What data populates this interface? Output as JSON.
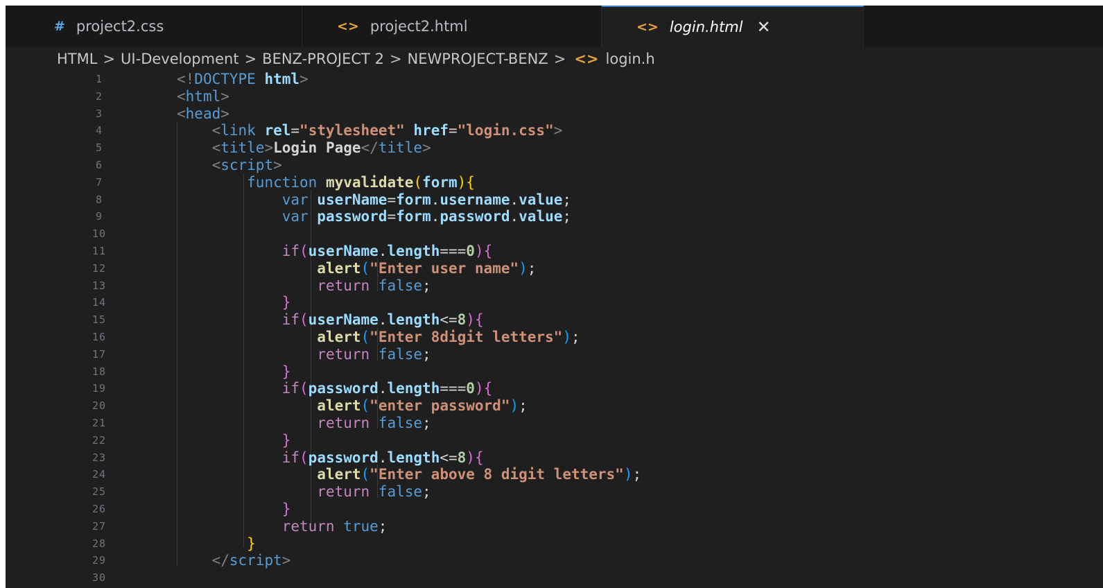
{
  "tabs": [
    {
      "label": "project2.css",
      "icon": "#"
    },
    {
      "label": "project2.html",
      "icon": "<>"
    },
    {
      "label": "login.html",
      "icon": "<>",
      "close": "✕"
    }
  ],
  "breadcrumb": [
    "HTML",
    "UI-Development",
    "BENZ-PROJECT 2",
    "NEWPROJECT-BENZ",
    "login.h"
  ],
  "breadcrumb_separator": ">",
  "breadcrumb_file_icon": "<>",
  "line_numbers": [
    "1",
    "2",
    "3",
    "4",
    "5",
    "6",
    "7",
    "8",
    "9",
    "10",
    "11",
    "12",
    "13",
    "14",
    "15",
    "16",
    "17",
    "18",
    "19",
    "20",
    "21",
    "22",
    "23",
    "24",
    "25",
    "26",
    "27",
    "28",
    "29",
    "30"
  ],
  "code_lines": [
    [
      [
        "<!",
        "punct"
      ],
      [
        "DOCTYPE",
        "tag"
      ],
      [
        " html",
        "attr bold"
      ],
      [
        ">",
        "punct"
      ]
    ],
    [
      [
        "<",
        "punct"
      ],
      [
        "html",
        "tag"
      ],
      [
        ">",
        "punct"
      ]
    ],
    [
      [
        "<",
        "punct"
      ],
      [
        "head",
        "tag"
      ],
      [
        ">",
        "punct"
      ]
    ],
    [
      [
        "    ",
        "text"
      ],
      [
        "<",
        "punct"
      ],
      [
        "link",
        "tag"
      ],
      [
        " rel",
        "attr bold"
      ],
      [
        "=",
        "text"
      ],
      [
        "\"stylesheet\"",
        "str bold"
      ],
      [
        " href",
        "attr bold"
      ],
      [
        "=",
        "text"
      ],
      [
        "\"login.css\"",
        "str bold"
      ],
      [
        ">",
        "punct"
      ]
    ],
    [
      [
        "    ",
        "text"
      ],
      [
        "<",
        "punct"
      ],
      [
        "title",
        "tag"
      ],
      [
        ">",
        "punct"
      ],
      [
        "Login Page",
        "text bold"
      ],
      [
        "</",
        "punct"
      ],
      [
        "title",
        "tag"
      ],
      [
        ">",
        "punct"
      ]
    ],
    [
      [
        "    ",
        "text"
      ],
      [
        "<",
        "punct"
      ],
      [
        "script",
        "tag"
      ],
      [
        ">",
        "punct"
      ]
    ],
    [
      [
        "        ",
        "text"
      ],
      [
        "function",
        "kw"
      ],
      [
        " myvalidate",
        "fn bold"
      ],
      [
        "(",
        "brk1"
      ],
      [
        "form",
        "var bold"
      ],
      [
        ")",
        "brk1"
      ],
      [
        "{",
        "brk1"
      ]
    ],
    [
      [
        "            ",
        "text"
      ],
      [
        "var",
        "kw"
      ],
      [
        " userName",
        "var bold"
      ],
      [
        "=",
        "text"
      ],
      [
        "form",
        "var bold"
      ],
      [
        ".",
        "text"
      ],
      [
        "username",
        "var bold"
      ],
      [
        ".",
        "text"
      ],
      [
        "value",
        "var bold"
      ],
      [
        ";",
        "text"
      ]
    ],
    [
      [
        "            ",
        "text"
      ],
      [
        "var",
        "kw"
      ],
      [
        " password",
        "var bold"
      ],
      [
        "=",
        "text"
      ],
      [
        "form",
        "var bold"
      ],
      [
        ".",
        "text"
      ],
      [
        "password",
        "var bold"
      ],
      [
        ".",
        "text"
      ],
      [
        "value",
        "var bold"
      ],
      [
        ";",
        "text"
      ]
    ],
    [
      [
        "",
        "text"
      ]
    ],
    [
      [
        "            ",
        "text"
      ],
      [
        "if",
        "ctrl"
      ],
      [
        "(",
        "brk2"
      ],
      [
        "userName",
        "var bold"
      ],
      [
        ".",
        "text"
      ],
      [
        "length",
        "var bold"
      ],
      [
        "===",
        "text"
      ],
      [
        "0",
        "num bold"
      ],
      [
        ")",
        "brk2"
      ],
      [
        "{",
        "brk2"
      ]
    ],
    [
      [
        "                ",
        "text"
      ],
      [
        "alert",
        "fn bold"
      ],
      [
        "(",
        "brk3"
      ],
      [
        "\"Enter user name\"",
        "str bold"
      ],
      [
        ")",
        "brk3"
      ],
      [
        ";",
        "text"
      ]
    ],
    [
      [
        "                ",
        "text"
      ],
      [
        "return",
        "ctrl"
      ],
      [
        " false",
        "kw"
      ],
      [
        ";",
        "text"
      ]
    ],
    [
      [
        "            ",
        "text"
      ],
      [
        "}",
        "brk2"
      ]
    ],
    [
      [
        "            ",
        "text"
      ],
      [
        "if",
        "ctrl"
      ],
      [
        "(",
        "brk2"
      ],
      [
        "userName",
        "var bold"
      ],
      [
        ".",
        "text"
      ],
      [
        "length",
        "var bold"
      ],
      [
        "<=",
        "text"
      ],
      [
        "8",
        "num bold"
      ],
      [
        ")",
        "brk2"
      ],
      [
        "{",
        "brk2"
      ]
    ],
    [
      [
        "                ",
        "text"
      ],
      [
        "alert",
        "fn bold"
      ],
      [
        "(",
        "brk3"
      ],
      [
        "\"Enter 8digit letters\"",
        "str bold"
      ],
      [
        ")",
        "brk3"
      ],
      [
        ";",
        "text"
      ]
    ],
    [
      [
        "                ",
        "text"
      ],
      [
        "return",
        "ctrl"
      ],
      [
        " false",
        "kw"
      ],
      [
        ";",
        "text"
      ]
    ],
    [
      [
        "            ",
        "text"
      ],
      [
        "}",
        "brk2"
      ]
    ],
    [
      [
        "            ",
        "text"
      ],
      [
        "if",
        "ctrl"
      ],
      [
        "(",
        "brk2"
      ],
      [
        "password",
        "var bold"
      ],
      [
        ".",
        "text"
      ],
      [
        "length",
        "var bold"
      ],
      [
        "===",
        "text"
      ],
      [
        "0",
        "num bold"
      ],
      [
        ")",
        "brk2"
      ],
      [
        "{",
        "brk2"
      ]
    ],
    [
      [
        "                ",
        "text"
      ],
      [
        "alert",
        "fn bold"
      ],
      [
        "(",
        "brk3"
      ],
      [
        "\"enter password\"",
        "str bold"
      ],
      [
        ")",
        "brk3"
      ],
      [
        ";",
        "text"
      ]
    ],
    [
      [
        "                ",
        "text"
      ],
      [
        "return",
        "ctrl"
      ],
      [
        " false",
        "kw"
      ],
      [
        ";",
        "text"
      ]
    ],
    [
      [
        "            ",
        "text"
      ],
      [
        "}",
        "brk2"
      ]
    ],
    [
      [
        "            ",
        "text"
      ],
      [
        "if",
        "ctrl"
      ],
      [
        "(",
        "brk2"
      ],
      [
        "password",
        "var bold"
      ],
      [
        ".",
        "text"
      ],
      [
        "length",
        "var bold"
      ],
      [
        "<=",
        "text"
      ],
      [
        "8",
        "num bold"
      ],
      [
        ")",
        "brk2"
      ],
      [
        "{",
        "brk2"
      ]
    ],
    [
      [
        "                ",
        "text"
      ],
      [
        "alert",
        "fn bold"
      ],
      [
        "(",
        "brk3"
      ],
      [
        "\"Enter above 8 digit letters\"",
        "str bold"
      ],
      [
        ")",
        "brk3"
      ],
      [
        ";",
        "text"
      ]
    ],
    [
      [
        "                ",
        "text"
      ],
      [
        "return",
        "ctrl"
      ],
      [
        " false",
        "kw"
      ],
      [
        ";",
        "text"
      ]
    ],
    [
      [
        "            ",
        "text"
      ],
      [
        "}",
        "brk2"
      ]
    ],
    [
      [
        "            ",
        "text"
      ],
      [
        "return",
        "ctrl"
      ],
      [
        " true",
        "kw"
      ],
      [
        ";",
        "text"
      ]
    ],
    [
      [
        "        ",
        "text"
      ],
      [
        "}",
        "brk1"
      ]
    ],
    [
      [
        "    ",
        "text"
      ],
      [
        "</",
        "punct"
      ],
      [
        "script",
        "tag"
      ],
      [
        ">",
        "punct"
      ]
    ],
    [
      [
        "",
        "text"
      ]
    ]
  ],
  "colors": {
    "editor_bg": "#1f1f1f",
    "tabbar_bg": "#181818",
    "active_tab_border": "#3c7fd0",
    "tag": "#569cd6",
    "attribute": "#9cdcfe",
    "string": "#ce9178",
    "control": "#c586c0",
    "function": "#dcdcaa"
  }
}
